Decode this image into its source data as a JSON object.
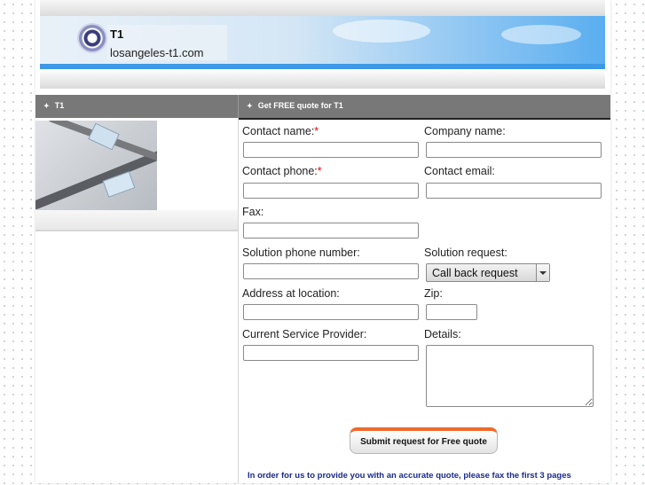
{
  "header": {
    "brand_name": "T1",
    "brand_url": "losangeles-t1.com"
  },
  "nav": {
    "left_title": "T1",
    "right_title": "Get FREE quote for T1"
  },
  "form": {
    "contact_name_label": "Contact name:",
    "company_name_label": "Company name:",
    "contact_phone_label": "Contact phone:",
    "contact_email_label": "Contact email:",
    "fax_label": "Fax:",
    "solution_phone_label": "Solution phone number:",
    "solution_request_label": "Solution request:",
    "solution_request_value": "Call back request",
    "address_label": "Address at location:",
    "zip_label": "Zip:",
    "provider_label": "Current Service Provider:",
    "details_label": "Details:",
    "required_mark": "*",
    "submit_label": "Submit request for Free quote",
    "note": "In order for us to provide you with an accurate quote, please fax the first 3 pages"
  },
  "colors": {
    "band": "#787878",
    "required": "#ee0000",
    "note_text": "#1a2a8a",
    "submit_accent": "#ee6a2d"
  },
  "icons": {
    "logo": "circle-logo-icon",
    "bullet": "bullet-icon",
    "dropdown": "chevron-down-icon"
  }
}
